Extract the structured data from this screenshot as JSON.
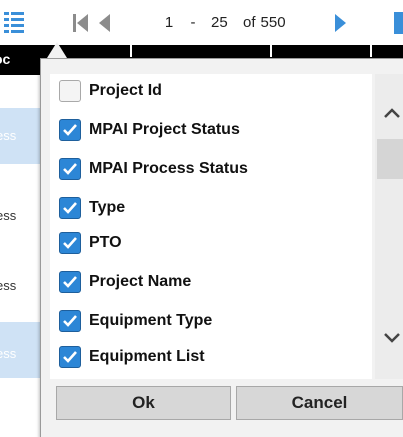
{
  "toolbar": {
    "column_chooser_icon": "column-chooser-icon",
    "first_icon": "first-page-icon",
    "prev_icon": "prev-page-icon",
    "next_icon": "next-page-icon",
    "pager": {
      "start": "1",
      "dash": "-",
      "end": "25",
      "of": "of",
      "total": "550"
    }
  },
  "grid": {
    "header_label": "oc",
    "rows": [
      {
        "text": "ess",
        "highlight": true
      },
      {
        "text": "ess",
        "highlight": false
      },
      {
        "text": "ess",
        "highlight": false
      },
      {
        "text": "ess",
        "highlight": true
      }
    ]
  },
  "column_chooser": {
    "items": [
      {
        "label": "Project Id",
        "checked": false
      },
      {
        "label": "MPAI Project Status",
        "checked": true
      },
      {
        "label": "MPAI Process Status",
        "checked": true
      },
      {
        "label": "Type",
        "checked": true
      },
      {
        "label": "PTO",
        "checked": true
      },
      {
        "label": "Project Name",
        "checked": true
      },
      {
        "label": "Equipment Type",
        "checked": true
      },
      {
        "label": "Equipment List",
        "checked": true
      }
    ],
    "ok_label": "Ok",
    "cancel_label": "Cancel"
  },
  "colors": {
    "accent": "#2c86d6",
    "header_bg": "#000000",
    "popup_bg": "#f2f2f2",
    "row_highlight": "#cfe2f5"
  }
}
